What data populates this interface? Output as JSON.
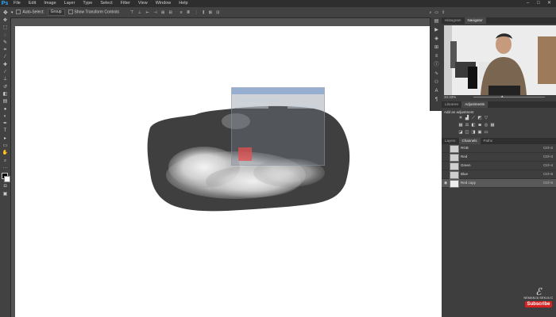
{
  "app": {
    "logo": "Ps"
  },
  "menu": [
    "File",
    "Edit",
    "Image",
    "Layer",
    "Type",
    "Select",
    "Filter",
    "View",
    "Window",
    "Help"
  ],
  "options": {
    "auto_select_label": "Auto-Select:",
    "auto_select_value": "Group",
    "transform_label": "Show Transform Controls"
  },
  "panels": {
    "top_tabs": [
      "Histogram",
      "Navigator"
    ],
    "zoom": "33.33%",
    "adj_tabs": [
      "Libraries",
      "Adjustments"
    ],
    "adj_title": "Add an adjustment",
    "bottom_tabs": [
      "Layers",
      "Channels",
      "Paths"
    ],
    "channels": [
      {
        "name": "RGB",
        "key": "Ctrl+2"
      },
      {
        "name": "Red",
        "key": "Ctrl+3"
      },
      {
        "name": "Green",
        "key": "Ctrl+4"
      },
      {
        "name": "Blue",
        "key": "Ctrl+5"
      },
      {
        "name": "Red copy",
        "key": "Ctrl+6"
      }
    ]
  },
  "watermark": {
    "name": "NEMANJA SEKULIC",
    "subscribe": "Subscribe"
  },
  "colors": {
    "accent": "#31a8ff",
    "subscribe": "#d62222"
  },
  "icons": [
    "move-tool-icon",
    "marquee-tool-icon",
    "lasso-tool-icon",
    "quick-select-tool-icon",
    "crop-tool-icon",
    "eyedropper-tool-icon",
    "healing-brush-icon",
    "brush-tool-icon",
    "clone-stamp-icon",
    "history-brush-icon",
    "eraser-tool-icon",
    "gradient-tool-icon",
    "blur-tool-icon",
    "dodge-tool-icon",
    "pen-tool-icon",
    "type-tool-icon",
    "path-select-icon",
    "rectangle-tool-icon",
    "hand-tool-icon",
    "zoom-tool-icon"
  ]
}
